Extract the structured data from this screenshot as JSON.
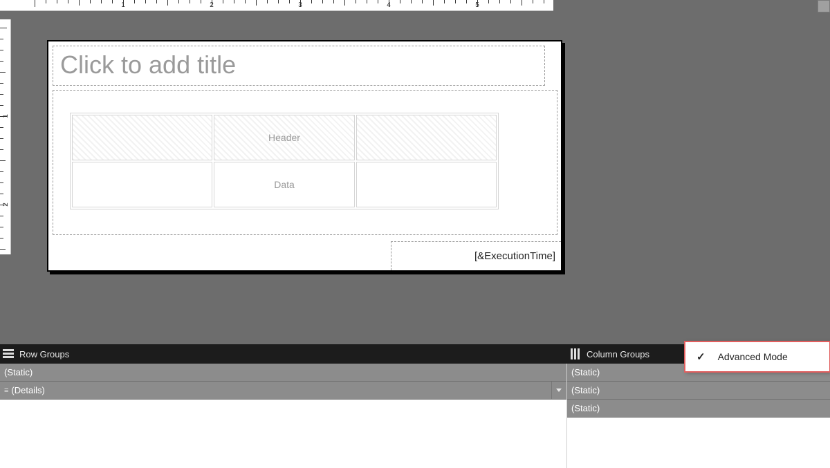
{
  "ruler_numbers_h": [
    "1",
    "2",
    "3",
    "4",
    "5"
  ],
  "ruler_numbers_v": [
    "1",
    "2"
  ],
  "title_placeholder": "Click to add title",
  "tablix": {
    "header_label": "Header",
    "data_label": "Data"
  },
  "footer_expression": "[&ExecutionTime]",
  "row_groups": {
    "title": "Row Groups",
    "items": [
      "(Static)",
      "(Details)"
    ]
  },
  "column_groups": {
    "title": "Column Groups",
    "items": [
      "(Static)",
      "(Static)",
      "(Static)"
    ]
  },
  "menu": {
    "advanced_mode": "Advanced Mode",
    "checked": true
  }
}
